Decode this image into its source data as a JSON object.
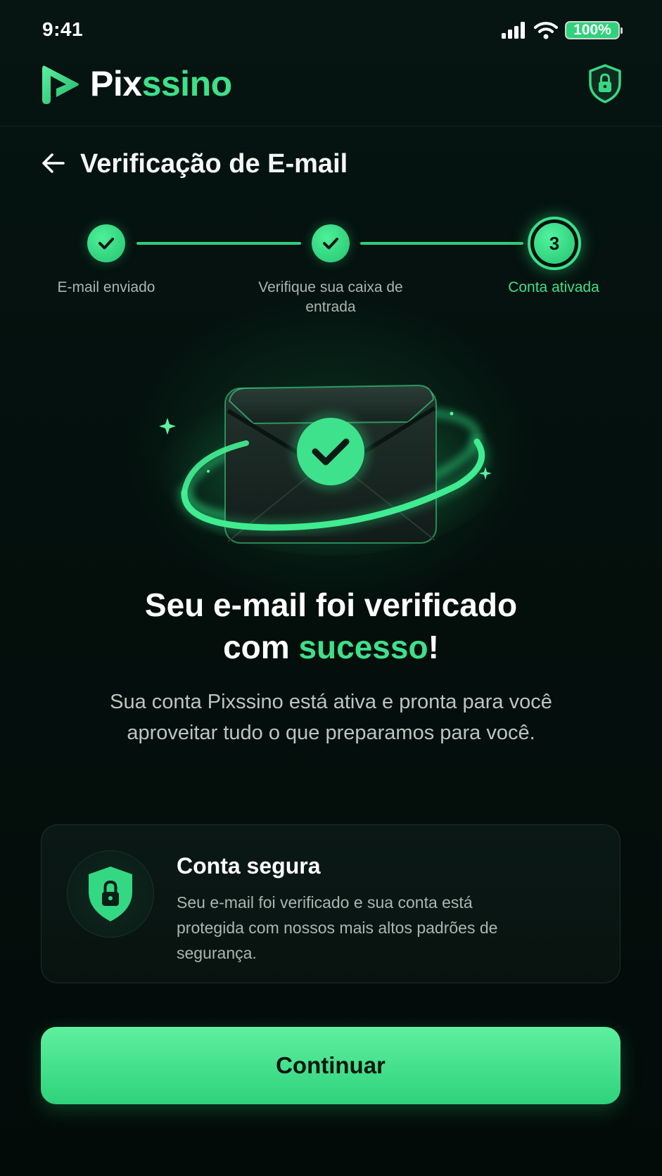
{
  "status_bar": {
    "time": "9:41",
    "battery": "100%"
  },
  "brand": {
    "name_part1": "Pix",
    "name_part2": "ssino"
  },
  "header": {
    "title": "Verificação de E-mail"
  },
  "stepper": {
    "steps": [
      {
        "label": "E-mail enviado",
        "state": "done"
      },
      {
        "label": "Verifique sua caixa de entrada",
        "state": "done"
      },
      {
        "label": "Conta ativada",
        "number": "3",
        "state": "active"
      }
    ]
  },
  "hero": {
    "headline_line1": "Seu e-mail foi verificado",
    "headline_line2_prefix": "com ",
    "headline_accent": "sucesso",
    "headline_suffix": "!",
    "description": "Sua conta Pixssino está ativa e pronta para você aproveitar tudo o que preparamos para você."
  },
  "security_card": {
    "title": "Conta segura",
    "text": "Seu e-mail foi verificado e sua conta está protegida com nossos mais altos padrões de segurança."
  },
  "actions": {
    "continue_label": "Continuar"
  },
  "colors": {
    "accent": "#3ee08a",
    "background": "#04100d",
    "button_text": "#08160f"
  }
}
